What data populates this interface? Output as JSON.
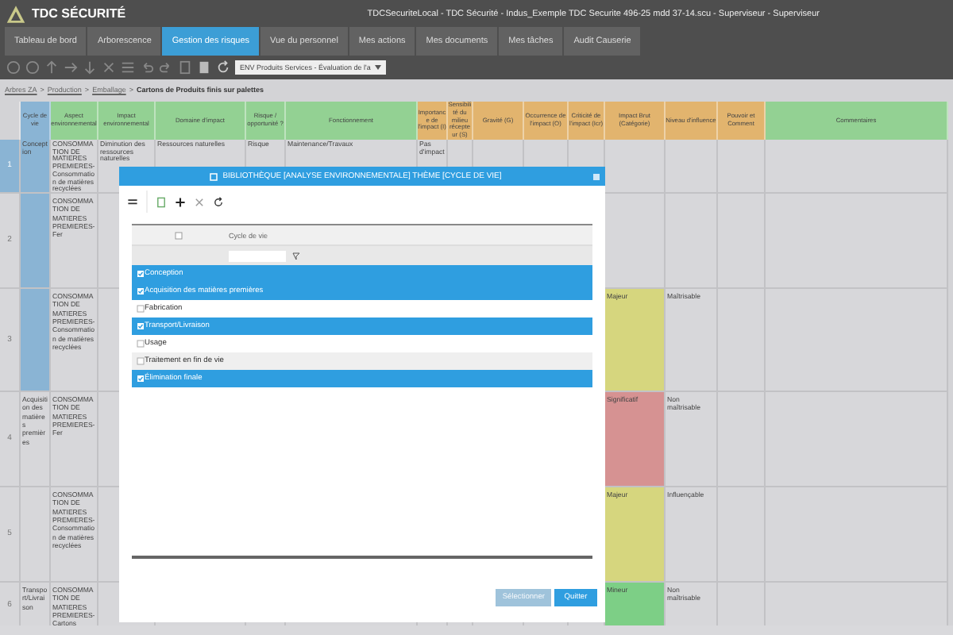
{
  "app": {
    "logo": "TDC SÉCURITÉ",
    "title": "TDCSecuriteLocal - TDC Sécurité - Indus_Exemple TDC Securite 496-25 mdd 37-14.scu - Superviseur - Superviseur"
  },
  "tabs": [
    {
      "label": "Tableau de bord",
      "selected": false
    },
    {
      "label": "Arborescence",
      "selected": false
    },
    {
      "label": "Gestion des risques",
      "selected": true
    },
    {
      "label": "Vue du personnel",
      "selected": false
    },
    {
      "label": "Mes actions",
      "selected": false
    },
    {
      "label": "Mes documents",
      "selected": false
    },
    {
      "label": "Mes tâches",
      "selected": false
    },
    {
      "label": "Audit Causerie",
      "selected": false
    }
  ],
  "toolbar": {
    "dropdown": "ENV Produits Services - Évaluation de l'a"
  },
  "breadcrumb": {
    "separator": ">",
    "items": [
      "Arbres ZA",
      "Production",
      "Emballage",
      "Cartons de Produits finis sur palettes"
    ]
  },
  "table": {
    "columns": [
      {
        "label": "Cycle de vie",
        "color": "#8ab4d4"
      },
      {
        "label": "Aspect environnemental",
        "color": "#93d193"
      },
      {
        "label": "Impact environnemental",
        "color": "#93d193"
      },
      {
        "label": "Domaine d'impact",
        "color": "#93d193"
      },
      {
        "label": "Risque / opportunité ?",
        "color": "#93d193"
      },
      {
        "label": "Fonctionnement",
        "color": "#93d193"
      },
      {
        "label": "Importance de l'impact (I)",
        "color": "#e2b46e"
      },
      {
        "label": "Sensibilité du milieu récepteur (S)",
        "color": "#e2b46e"
      },
      {
        "label": "Gravité (G)",
        "color": "#e2b46e"
      },
      {
        "label": "Occurrence de l'impact (O)",
        "color": "#e2b46e"
      },
      {
        "label": "Criticité de l'impact (Icr)",
        "color": "#e2b46e"
      },
      {
        "label": "Impact Brut (Catégorie)",
        "color": "#e2b46e"
      },
      {
        "label": "Niveau d'influence",
        "color": "#e2b46e"
      },
      {
        "label": "Pouvoir et Comment",
        "color": "#e2b46e"
      },
      {
        "label": "Commentaires",
        "color": "#93d193"
      }
    ],
    "rows": [
      {
        "number": "1",
        "selected": true,
        "cycle_selected": true,
        "cycle": "Conception",
        "aspect": "CONSOMMATION DE MATIERES PREMIERES-Consommation de matières recyclées",
        "impact": "Diminution des ressources naturelles",
        "domain": "Ressources naturelles",
        "risk": "Risque",
        "operation": "Maintenance/Travaux",
        "importance": "Pas d'impact"
      },
      {
        "number": "2",
        "selected": false,
        "cycle_selected": true,
        "aspect": "CONSOMMATION DE MATIERES PREMIERES-Fer"
      },
      {
        "number": "3",
        "selected": false,
        "cycle_selected": true,
        "aspect": "CONSOMMATION DE MATIERES PREMIERES-Consommation de matières recyclées",
        "category": {
          "label": "Majeur",
          "color": "#d6d67e"
        },
        "influence": "Maîtrisable"
      },
      {
        "number": "4",
        "selected": false,
        "cycle_selected": false,
        "cycle": "Acquisition des matières premières",
        "aspect": "CONSOMMATION DE MATIERES PREMIERES-Fer",
        "category": {
          "label": "Significatif",
          "color": "#d69292"
        },
        "influence": "Non maîtrisable"
      },
      {
        "number": "5",
        "selected": false,
        "cycle_selected": false,
        "aspect": "CONSOMMATION DE MATIERES PREMIERES-Consommation de matières recyclées",
        "category": {
          "label": "Majeur",
          "color": "#d6d67e"
        },
        "influence": "Influençable"
      },
      {
        "number": "6",
        "selected": false,
        "cycle_selected": false,
        "cycle": "Transport/Livraison",
        "aspect": "CONSOMMATION DE MATIERES PREMIERES-Cartons",
        "category": {
          "label": "Mineur",
          "color": "#7dcf86"
        },
        "influence": "Non maîtrisable"
      }
    ]
  },
  "dialog": {
    "title": "BIBLIOTHÈQUE [ANALYSE ENVIRONNEMENTALE] THÈME [CYCLE DE VIE]",
    "column": "Cycle de vie",
    "all_selected": false,
    "items": [
      {
        "label": "Conception",
        "selected": true
      },
      {
        "label": "Acquisition des matières premières",
        "selected": true
      },
      {
        "label": "Fabrication",
        "selected": false
      },
      {
        "label": "Transport/Livraison",
        "selected": true
      },
      {
        "label": "Usage",
        "selected": false
      },
      {
        "label": "Traitement en fin de vie",
        "selected": false
      },
      {
        "label": "Élimination finale",
        "selected": true
      }
    ],
    "buttons": [
      {
        "label": "Sélectionner",
        "disabled": true
      },
      {
        "label": "Quitter",
        "disabled": false
      }
    ]
  }
}
